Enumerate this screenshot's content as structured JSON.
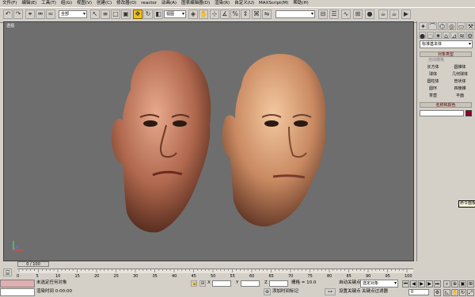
{
  "menu": [
    "文件(F)",
    "编辑(E)",
    "工具(T)",
    "组(G)",
    "视图(V)",
    "创建(C)",
    "修改器(O)",
    "reactor",
    "动画(A)",
    "图表编辑器(D)",
    "渲染(R)",
    "自定义(U)",
    "MAXScript(M)",
    "帮助(H)"
  ],
  "toolbar": {
    "selection_filter": "全部",
    "ref_coord": "视图",
    "named_selection": ""
  },
  "viewport": {
    "label": "透视"
  },
  "command_panel": {
    "category_dropdown": "标准基本体",
    "object_type_header": "对象类型",
    "autogrid_label": "自动栅格",
    "objects": [
      "长方体",
      "圆锥体",
      "球体",
      "几何球体",
      "圆柱体",
      "管状体",
      "圆环",
      "四棱锥",
      "茶壶",
      "平面"
    ],
    "name_color_header": "名称和颜色"
  },
  "tooltip": "命令面板",
  "timeline": {
    "frame_display": "0 / 100",
    "ticks": [
      "0",
      "5",
      "10",
      "15",
      "20",
      "25",
      "30",
      "35",
      "40",
      "45",
      "50",
      "55",
      "60",
      "65",
      "70",
      "75",
      "80",
      "85",
      "90",
      "95",
      "100"
    ]
  },
  "status": {
    "selection": "未选定任何对象",
    "prompt": "渲染时间  0:00:00",
    "x_label": "X",
    "y_label": "Y",
    "z_label": "Z",
    "grid": "栅格 = 10.0",
    "add_time_tag": "添加时间标记",
    "auto_key": "自动关键点",
    "set_key": "设置关键点",
    "selected_set": "选定对象",
    "key_filters": "关键点过滤器",
    "frame_field": "0"
  },
  "colors": {
    "viewport_bg": "#6e6e6e",
    "ui_bg": "#d4d0c8",
    "key_red": "#e0b0b0",
    "swatch": "#8b0030"
  }
}
